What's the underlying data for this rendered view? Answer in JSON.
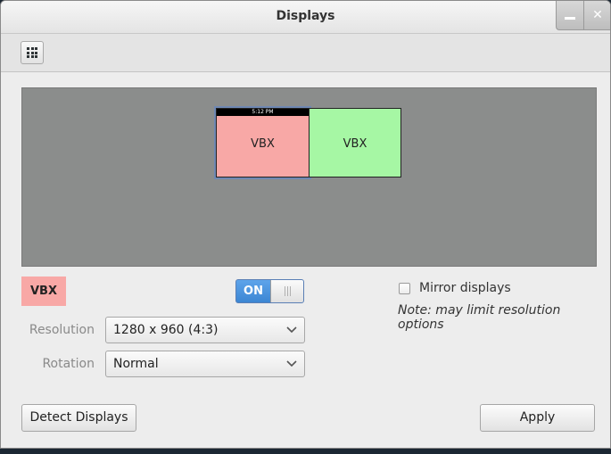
{
  "window": {
    "title": "Displays",
    "minimize_icon": "minimize-icon",
    "close_icon": "close-icon",
    "close_glyph": "✕"
  },
  "toolbar": {
    "all_settings_icon": "grid-icon"
  },
  "preview": {
    "monitors": [
      {
        "label": "VBX",
        "color": "#f8a8a6",
        "panel_text": "5:12 PM",
        "selected": true
      },
      {
        "label": "VBX",
        "color": "#a6f7a4",
        "selected": false
      }
    ]
  },
  "selected_display": {
    "name": "VBX",
    "color": "#f8a8a6",
    "power_toggle": {
      "label": "ON",
      "state": true
    }
  },
  "mirror": {
    "label": "Mirror displays",
    "checked": false,
    "note": "Note: may limit resolution options"
  },
  "settings": {
    "resolution_label": "Resolution",
    "resolution_value": "1280 x 960 (4:3)",
    "rotation_label": "Rotation",
    "rotation_value": "Normal"
  },
  "buttons": {
    "detect_label": "Detect Displays",
    "apply_label": "Apply"
  },
  "colors": {
    "accent": "#4a90d9",
    "preview_bg": "#8b8d8c"
  }
}
